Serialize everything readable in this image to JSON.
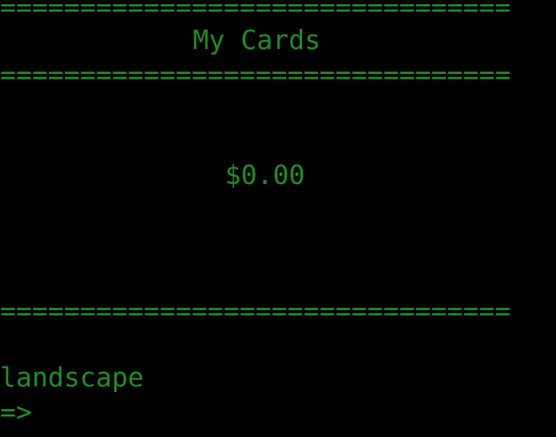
{
  "terminal": {
    "rule": "================================",
    "title": "My Cards",
    "balance": "$0.00",
    "last_command": "landscape",
    "prompt": "=>"
  }
}
